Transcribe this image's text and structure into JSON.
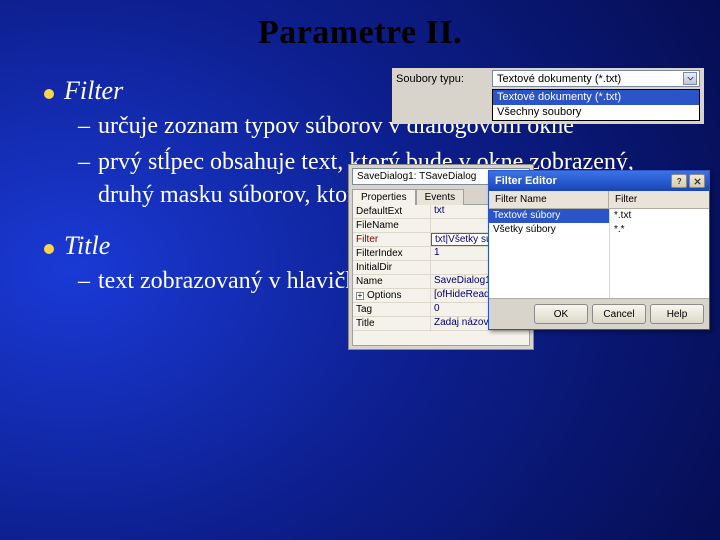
{
  "title": "Parametre II.",
  "sections": [
    {
      "heading": "Filter",
      "items": [
        "určuje zoznam typov súborov v dialógovom okne",
        "prvý stĺpec obsahuje text, ktorý bude v okne zobrazený, druhý masku súborov, ktoré sa budú zobrazovať"
      ]
    },
    {
      "heading": "Title",
      "items": [
        "text zobrazovaný v hlavičke ukladacieho dialógu"
      ]
    }
  ],
  "dropdown": {
    "label": "Soubory typu:",
    "selected": "Textové dokumenty (*.txt)",
    "options": [
      "Textové dokumenty (*.txt)",
      "Všechny soubory"
    ],
    "highlighted_index": 0
  },
  "object_inspector": {
    "combo": "SaveDialog1: TSaveDialog",
    "tabs": [
      "Properties",
      "Events"
    ],
    "active_tab": 0,
    "rows": [
      {
        "key": "DefaultExt",
        "value": "txt"
      },
      {
        "key": "FileName",
        "value": ""
      },
      {
        "key": "Filter",
        "value": "txt|Všetky súbory|*.*",
        "selected": true
      },
      {
        "key": "FilterIndex",
        "value": "1"
      },
      {
        "key": "InitialDir",
        "value": ""
      },
      {
        "key": "Name",
        "value": "SaveDialog1"
      },
      {
        "key": "Options",
        "value": "[ofHideReadOnly,ofEn",
        "expandable": true
      },
      {
        "key": "Tag",
        "value": "0"
      },
      {
        "key": "Title",
        "value": "Zadaj názov súboru"
      }
    ],
    "footer_label": "Filter"
  },
  "filter_editor": {
    "title": "Filter Editor",
    "columns": [
      "Filter Name",
      "Filter"
    ],
    "rows": [
      {
        "name": "Textové súbory",
        "mask": "*.txt",
        "selected": true
      },
      {
        "name": "Všetky súbory",
        "mask": "*.*"
      }
    ],
    "buttons": {
      "ok": "OK",
      "cancel": "Cancel",
      "help": "Help"
    }
  }
}
